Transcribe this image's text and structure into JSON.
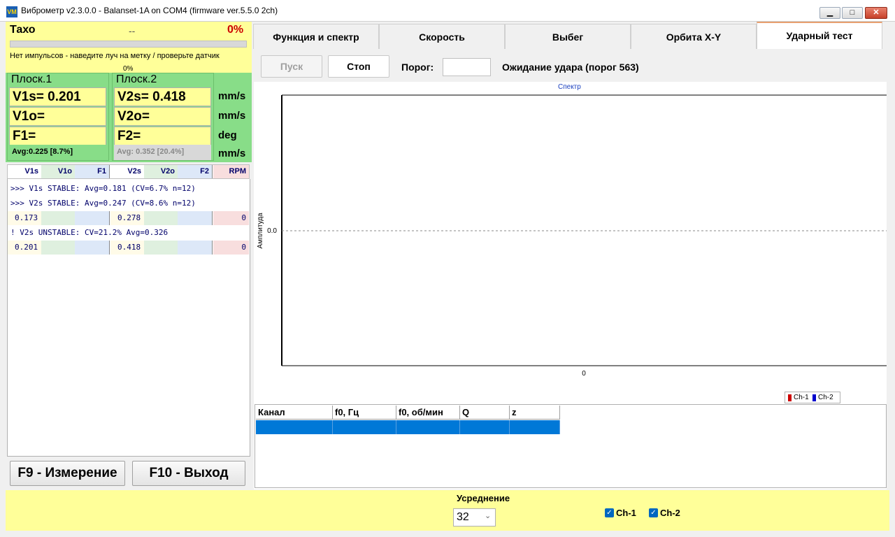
{
  "window": {
    "app_icon": "VM",
    "title": "Виброметр v2.3.0.0 - Balanset-1A on COM4 (firmware ver.5.5.0 2ch)",
    "minimize": "▁",
    "maximize": "□",
    "close": "✕"
  },
  "taxo": {
    "label": "Тахо",
    "value": "--",
    "percent": "0%",
    "progress_fraction": 0,
    "message": "Нет импульсов - наведите луч на метку / проверьте датчик",
    "bar_percent": "0%"
  },
  "planes": {
    "plane1": {
      "title": "Плоск.1",
      "v_s": "V1s= 0.201",
      "v_o": "V1o=",
      "f": "F1=",
      "avg": "Avg:0.225 [8.7%]"
    },
    "plane2": {
      "title": "Плоск.2",
      "v_s": "V2s= 0.418",
      "v_o": "V2o=",
      "f": "F2=",
      "avg": "Avg: 0.352 [20.4%]"
    },
    "units": [
      "mm/s",
      "mm/s",
      "deg",
      "mm/s"
    ]
  },
  "history": {
    "columns": [
      "V1s",
      "V1o",
      "F1",
      "V2s",
      "V2o",
      "F2",
      "RPM"
    ],
    "lines": [
      ">>> V1s STABLE: Avg=0.181 (CV=6.7% n=12)",
      ">>> V2s STABLE: Avg=0.247 (CV=8.6% n=12)"
    ],
    "row1": {
      "v1s": "0.173",
      "v2s": "0.278",
      "rpm": "0"
    },
    "warning": "! V2s UNSTABLE: CV=21.2% Avg=0.326",
    "row2": {
      "v1s": "0.201",
      "v2s": "0.418",
      "rpm": "0"
    }
  },
  "buttons": {
    "f9": "F9 - Измерение",
    "f10": "F10 - Выход"
  },
  "tabs": [
    "Функция и спектр",
    "Скорость",
    "Выбег",
    "Орбита X-Y",
    "Ударный тест"
  ],
  "active_tab": "Ударный тест",
  "impact": {
    "start": "Пуск",
    "stop": "Стоп",
    "threshold_label": "Порог:",
    "threshold_value": "",
    "status": "Ожидание удара (порог 563)"
  },
  "chart_data": {
    "type": "line",
    "title": "Спектр",
    "ylabel": "Амплитуда",
    "xlabel": "",
    "x_ticks": [
      "0"
    ],
    "y_ticks": [
      "0.0"
    ],
    "series": [
      {
        "name": "Ch-1",
        "color": "#cc0000",
        "values": []
      },
      {
        "name": "Ch-2",
        "color": "#0000cc",
        "values": []
      }
    ]
  },
  "results_table": {
    "columns": [
      "Канал",
      "f0, Гц",
      "f0, об/мин",
      "Q",
      "z"
    ]
  },
  "averaging": {
    "label": "Усреднение",
    "value": "32",
    "ch1": "Ch-1",
    "ch2": "Ch-2",
    "ch1_checked": true,
    "ch2_checked": true
  },
  "colors": {
    "yellow": "#ffff99",
    "green": "#88dd88",
    "accent_blue": "#0078d7",
    "danger": "#cc0000"
  }
}
